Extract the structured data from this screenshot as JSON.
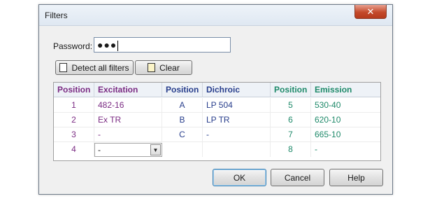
{
  "window": {
    "title": "Filters",
    "close_glyph": "✕"
  },
  "password": {
    "label": "Password:",
    "value": "●●●"
  },
  "buttons": {
    "detect_all_filters": "Detect all filters",
    "clear": "Clear",
    "ok": "OK",
    "cancel": "Cancel",
    "help": "Help"
  },
  "colors": {
    "excitation": "#7b2b83",
    "dichroic": "#283e8c",
    "emission": "#1f8a6a",
    "clear_icon_bg": "#fbf4c8"
  },
  "table": {
    "headers": {
      "excitation_position": "Position",
      "excitation": "Excitation",
      "dichroic_position": "Position",
      "dichroic": "Dichroic",
      "emission_position": "Position",
      "emission": "Emission"
    },
    "excitation_rows": [
      {
        "position": "1",
        "value": "482-16"
      },
      {
        "position": "2",
        "value": "Ex TR"
      },
      {
        "position": "3",
        "value": "-"
      },
      {
        "position": "4",
        "value": "-"
      }
    ],
    "dichroic_rows": [
      {
        "position": "A",
        "value": "LP 504"
      },
      {
        "position": "B",
        "value": "LP TR"
      },
      {
        "position": "C",
        "value": "-"
      }
    ],
    "emission_rows": [
      {
        "position": "5",
        "value": "530-40"
      },
      {
        "position": "6",
        "value": "620-10"
      },
      {
        "position": "7",
        "value": "665-10"
      },
      {
        "position": "8",
        "value": "-"
      }
    ]
  },
  "icons": {
    "close": "close-icon",
    "dropdown": "chevron-down-icon",
    "checkbox": "checkbox-icon"
  }
}
